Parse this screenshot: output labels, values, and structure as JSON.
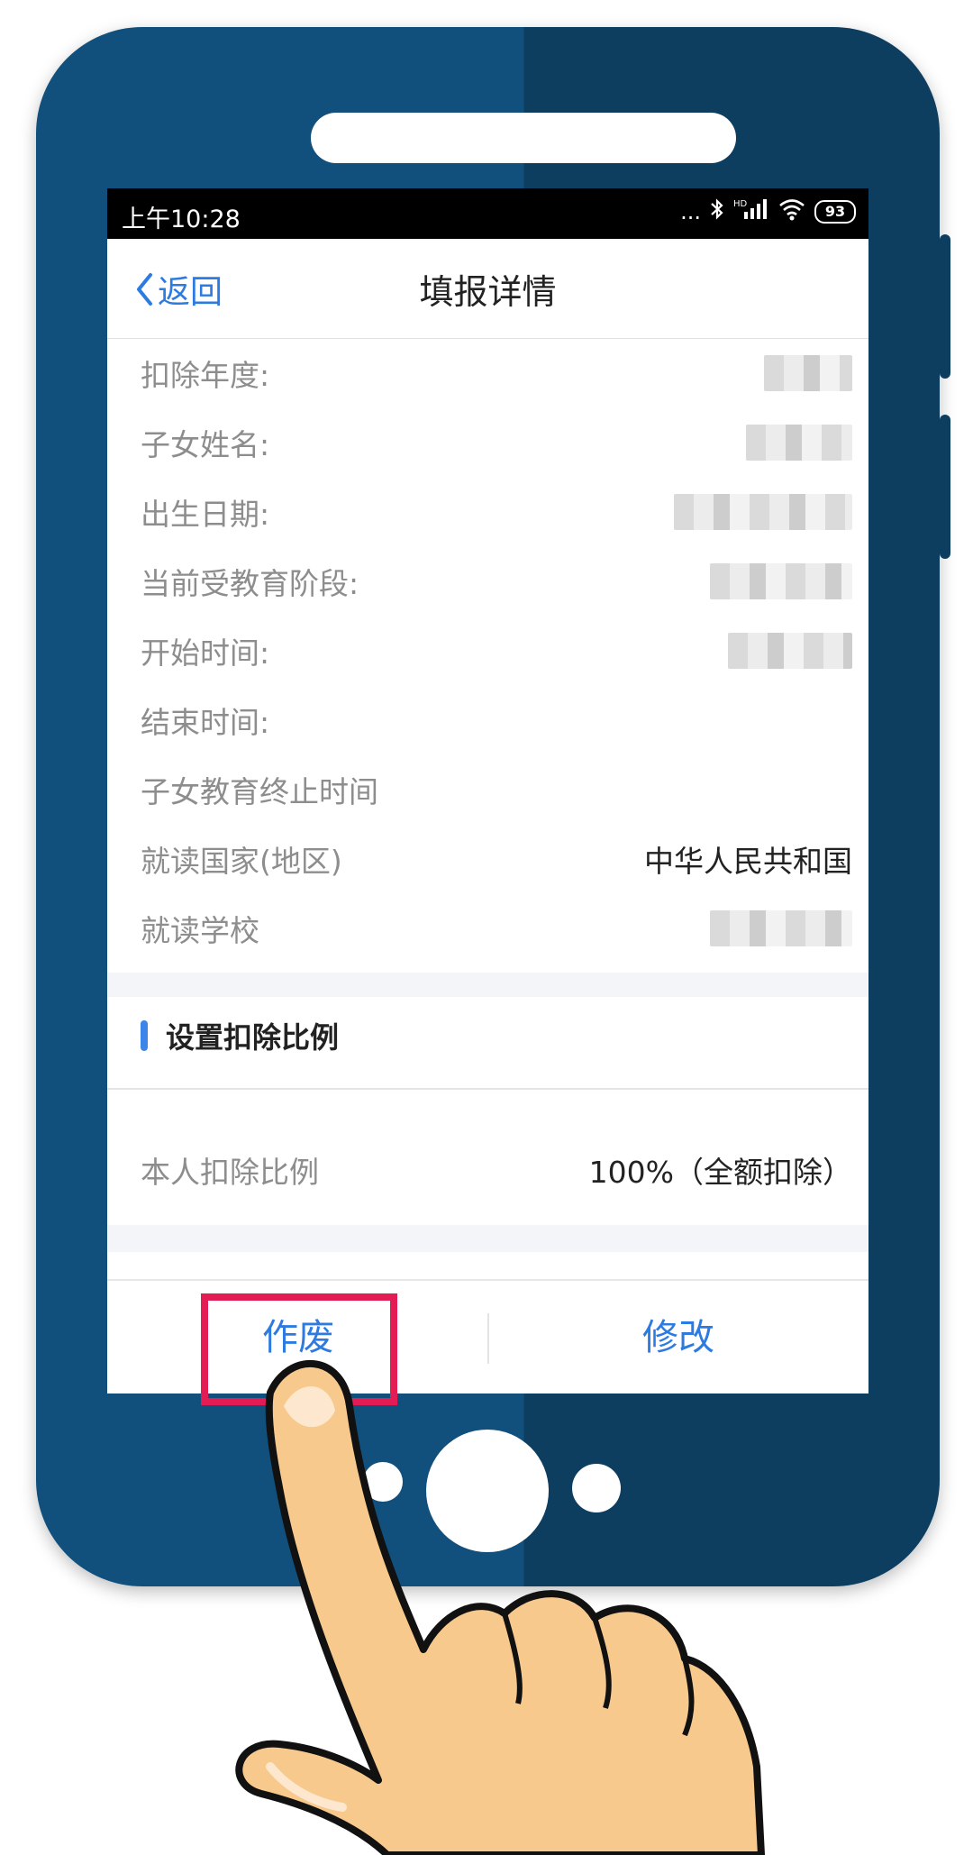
{
  "status_bar": {
    "time": "上午10:28",
    "signal_text": "...",
    "network": "HD",
    "battery": "93"
  },
  "nav": {
    "back_label": "返回",
    "title": "填报详情"
  },
  "details": [
    {
      "label": "扣除年度:",
      "value": "",
      "blurred": true
    },
    {
      "label": "子女姓名:",
      "value": "",
      "blurred": true
    },
    {
      "label": "出生日期:",
      "value": "",
      "blurred": true
    },
    {
      "label": "当前受教育阶段:",
      "value": "",
      "blurred": true
    },
    {
      "label": "开始时间:",
      "value": "",
      "blurred": true
    },
    {
      "label": "结束时间:",
      "value": ""
    },
    {
      "label": "子女教育终止时间",
      "value": ""
    },
    {
      "label": "就读国家(地区)",
      "value": "中华人民共和国"
    },
    {
      "label": "就读学校",
      "value": "",
      "blurred": true
    }
  ],
  "deduction_section": {
    "title": "设置扣除比例",
    "ratio_label": "本人扣除比例",
    "ratio_value": "100%（全额扣除）"
  },
  "actions": {
    "void_label": "作废",
    "edit_label": "修改"
  },
  "colors": {
    "accent": "#2d7be0",
    "highlight": "#e31c55",
    "phone_body": "#11507c"
  }
}
